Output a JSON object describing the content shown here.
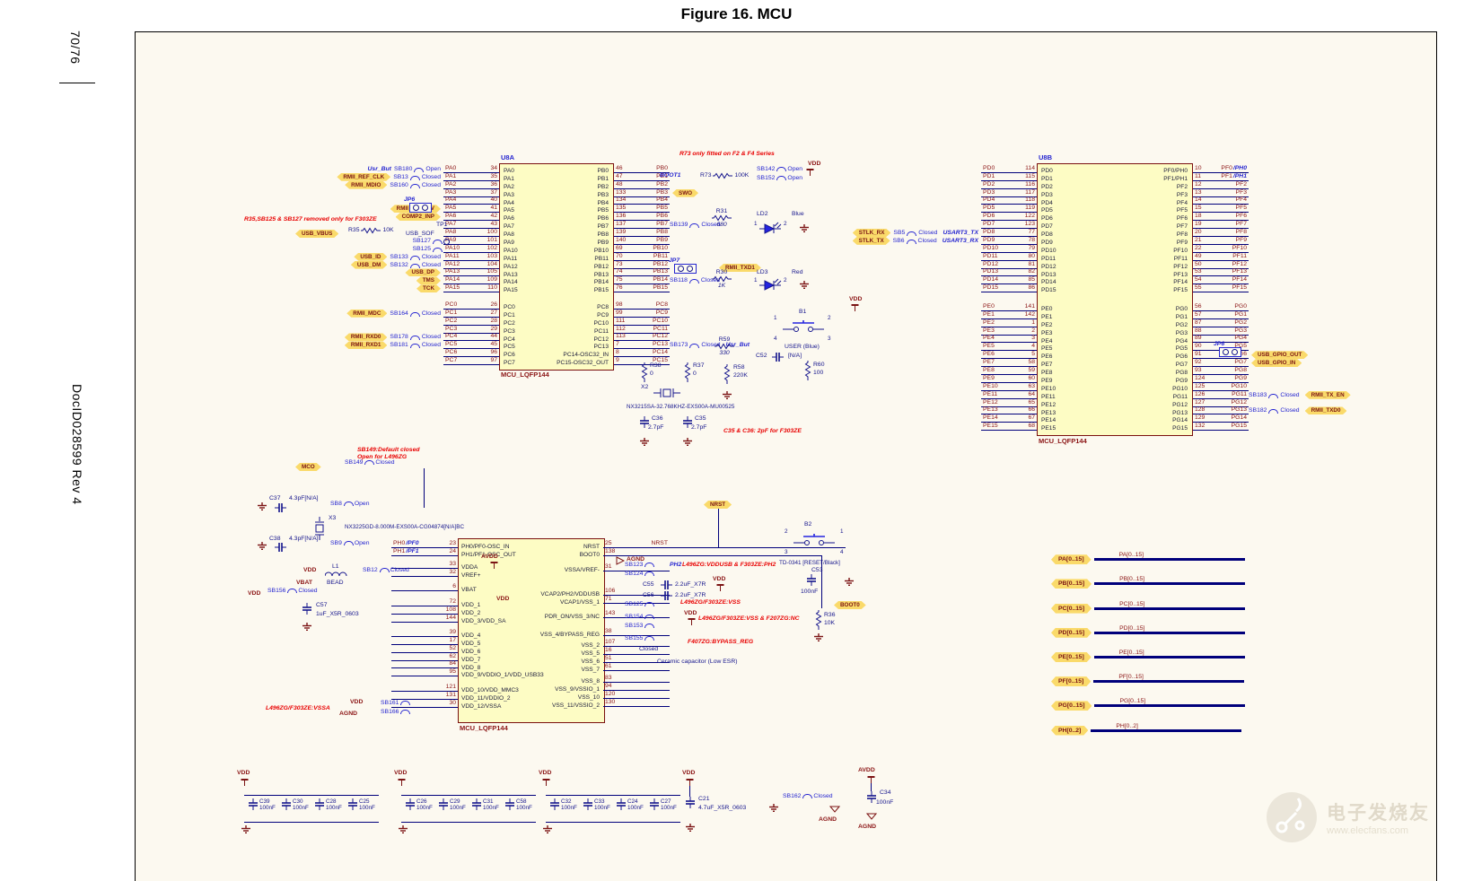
{
  "page": {
    "page_num": "70/76",
    "doc_id": "DocID028599 Rev 4",
    "title": "Figure 16. MCU",
    "watermark_cn": "电子发烧友",
    "watermark_url": "www.elecfans.com"
  },
  "u8a": {
    "ref": "U8A",
    "part": "MCU_LQFP144",
    "pa_rows": [
      {
        "pre": "Usr_But",
        "sb": "SB180",
        "state": "Open",
        "net": "PA0",
        "num": "34"
      },
      {
        "flag": "RMII_REF_CLK",
        "sb": "SB13",
        "state": "Closed",
        "net": "PA1",
        "num": "35"
      },
      {
        "flag": "RMII_MDIO",
        "sb": "SB160",
        "state": "Closed",
        "net": "PA2",
        "num": "36"
      },
      {
        "net": "PA3",
        "num": "37"
      },
      {
        "net": "PA4",
        "num": "40"
      },
      {
        "flag": "RMII_CRS_DV",
        "net": "PA5",
        "num": "41"
      },
      {
        "flag": "COMP2_INP",
        "net": "PA6",
        "num": "42"
      },
      {
        "net": "PA7",
        "num": "43"
      },
      {
        "net": "PA8",
        "num": "100"
      },
      {
        "sb": "SB127",
        "net": "PA9",
        "num": "101"
      },
      {
        "sb": "SB125",
        "net": "PA10",
        "num": "102"
      },
      {
        "flag": "USB_ID",
        "sb": "SB133",
        "state": "Closed",
        "net": "PA11",
        "num": "103"
      },
      {
        "flag": "USB_DM",
        "sb": "SB132",
        "state": "Closed",
        "net": "PA12",
        "num": "104"
      },
      {
        "flag": "USB_DP",
        "net": "PA13",
        "num": "105"
      },
      {
        "flag": "TMS",
        "net": "PA14",
        "num": "109"
      },
      {
        "flag": "TCK",
        "net": "PA15",
        "num": "110"
      }
    ],
    "pc_left_rows": [
      {
        "net": "PC0",
        "num": "26"
      },
      {
        "flag": "RMII_MDC",
        "sb": "SB164",
        "state": "Closed",
        "net": "PC1",
        "num": "27"
      },
      {
        "net": "PC2",
        "num": "28"
      },
      {
        "net": "PC3",
        "num": "29"
      },
      {
        "flag": "RMII_RXD0",
        "sb": "SB178",
        "state": "Closed",
        "net": "PC4",
        "num": "44"
      },
      {
        "flag": "RMII_RXD1",
        "sb": "SB181",
        "state": "Closed",
        "net": "PC5",
        "num": "45"
      },
      {
        "net": "PC6",
        "num": "96"
      },
      {
        "net": "PC7",
        "num": "97"
      }
    ],
    "pb_rows": [
      {
        "num": "46",
        "net": "PB0"
      },
      {
        "num": "47",
        "net": "PB1"
      },
      {
        "num": "48",
        "net": "PB2"
      },
      {
        "num": "133",
        "net": "PB3",
        "flag": "SWO"
      },
      {
        "num": "134",
        "net": "PB4"
      },
      {
        "num": "135",
        "net": "PB5"
      },
      {
        "num": "136",
        "net": "PB6"
      },
      {
        "num": "137",
        "net": "PB7",
        "sb": "SB139",
        "state": "Closed"
      },
      {
        "num": "139",
        "net": "PB8"
      },
      {
        "num": "140",
        "net": "PB9"
      },
      {
        "num": "69",
        "net": "PB10"
      },
      {
        "num": "70",
        "net": "PB11"
      },
      {
        "num": "73",
        "net": "PB12"
      },
      {
        "num": "74",
        "net": "PB13"
      },
      {
        "num": "75",
        "net": "PB14",
        "sb": "SB118",
        "state": "Closed"
      },
      {
        "num": "76",
        "net": "PB15"
      }
    ],
    "pc_right_rows": [
      {
        "num": "98",
        "net": "PC8"
      },
      {
        "num": "99",
        "net": "PC9"
      },
      {
        "num": "111",
        "net": "PC10"
      },
      {
        "num": "112",
        "net": "PC11"
      },
      {
        "num": "113",
        "net": "PC12"
      },
      {
        "num": "7",
        "net": "PC13",
        "sb": "SB173",
        "state": "Closed",
        "post": "Usr_But"
      },
      {
        "num": "8",
        "net": "PC14"
      },
      {
        "num": "9",
        "net": "PC15"
      }
    ],
    "in_pa": [
      "PA0",
      "PA1",
      "PA2",
      "PA3",
      "PA4",
      "PA5",
      "PA6",
      "PA7",
      "PA8",
      "PA9",
      "PA10",
      "PA11",
      "PA12",
      "PA13",
      "PA14",
      "PA15"
    ],
    "in_pc_l": [
      "PC0",
      "PC1",
      "PC2",
      "PC3",
      "PC4",
      "PC5",
      "PC6",
      "PC7"
    ],
    "in_pb": [
      "PB0",
      "PB1",
      "PB2",
      "PB3",
      "PB4",
      "PB5",
      "PB6",
      "PB7",
      "PB8",
      "PB9",
      "PB10",
      "PB11",
      "PB12",
      "PB13",
      "PB14",
      "PB15"
    ],
    "in_pc_r": [
      "PC8",
      "PC9",
      "PC10",
      "PC11",
      "PC12",
      "PC13",
      "PC14-OSC32_IN",
      "PC15-OSC32_OUT"
    ]
  },
  "u8b": {
    "ref": "U8B",
    "part": "MCU_LQFP144",
    "pd_rows": [
      {
        "net": "PD0",
        "num": "114"
      },
      {
        "net": "PD1",
        "num": "115"
      },
      {
        "net": "PD2",
        "num": "116"
      },
      {
        "net": "PD3",
        "num": "117"
      },
      {
        "net": "PD4",
        "num": "118"
      },
      {
        "net": "PD5",
        "num": "119"
      },
      {
        "net": "PD6",
        "num": "122"
      },
      {
        "net": "PD7",
        "num": "123"
      },
      {
        "flag": "STLK_RX",
        "sb": "SB5",
        "state": "Closed",
        "post": "USART3_TX",
        "net": "PD8",
        "num": "77"
      },
      {
        "flag": "STLK_TX",
        "sb": "SB6",
        "state": "Closed",
        "post": "USART3_RX",
        "net": "PD9",
        "num": "78"
      },
      {
        "net": "PD10",
        "num": "79"
      },
      {
        "net": "PD11",
        "num": "80"
      },
      {
        "net": "PD12",
        "num": "81"
      },
      {
        "net": "PD13",
        "num": "82"
      },
      {
        "net": "PD14",
        "num": "85"
      },
      {
        "net": "PD15",
        "num": "86"
      }
    ],
    "pe_rows": [
      {
        "net": "PE0",
        "num": "141"
      },
      {
        "net": "PE1",
        "num": "142"
      },
      {
        "net": "PE2",
        "num": "1"
      },
      {
        "net": "PE3",
        "num": "2"
      },
      {
        "net": "PE4",
        "num": "3"
      },
      {
        "net": "PE5",
        "num": "4"
      },
      {
        "net": "PE6",
        "num": "5"
      },
      {
        "net": "PE7",
        "num": "58"
      },
      {
        "net": "PE8",
        "num": "59"
      },
      {
        "net": "PE9",
        "num": "60"
      },
      {
        "net": "PE10",
        "num": "63"
      },
      {
        "net": "PE11",
        "num": "64"
      },
      {
        "net": "PE12",
        "num": "65"
      },
      {
        "net": "PE13",
        "num": "66"
      },
      {
        "net": "PE14",
        "num": "67"
      },
      {
        "net": "PE15",
        "num": "68"
      }
    ],
    "pf_rows": [
      {
        "num": "10",
        "net": "PF0",
        "alt": "/PH0"
      },
      {
        "num": "11",
        "net": "PF1",
        "alt": "/PH1"
      },
      {
        "num": "12",
        "net": "PF2"
      },
      {
        "num": "13",
        "net": "PF3"
      },
      {
        "num": "14",
        "net": "PF4"
      },
      {
        "num": "15",
        "net": "PF5"
      },
      {
        "num": "18",
        "net": "PF6"
      },
      {
        "num": "19",
        "net": "PF7"
      },
      {
        "num": "20",
        "net": "PF8"
      },
      {
        "num": "21",
        "net": "PF9"
      },
      {
        "num": "22",
        "net": "PF10"
      },
      {
        "num": "49",
        "net": "PF11"
      },
      {
        "num": "50",
        "net": "PF12"
      },
      {
        "num": "53",
        "net": "PF13"
      },
      {
        "num": "54",
        "net": "PF14"
      },
      {
        "num": "55",
        "net": "PF15"
      }
    ],
    "pg_rows": [
      {
        "num": "56",
        "net": "PG0"
      },
      {
        "num": "57",
        "net": "PG1"
      },
      {
        "num": "87",
        "net": "PG2"
      },
      {
        "num": "88",
        "net": "PG3"
      },
      {
        "num": "89",
        "net": "PG4"
      },
      {
        "num": "90",
        "net": "PG5"
      },
      {
        "num": "91",
        "net": "PG6",
        "flag": "USB_GPIO_OUT"
      },
      {
        "num": "92",
        "net": "PG7",
        "flag": "USB_GPIO_IN"
      },
      {
        "num": "93",
        "net": "PG8"
      },
      {
        "num": "124",
        "net": "PG9"
      },
      {
        "num": "125",
        "net": "PG10"
      },
      {
        "num": "126",
        "net": "PG11",
        "sb": "SB183",
        "state": "Closed",
        "flag": "RMII_TX_EN"
      },
      {
        "num": "127",
        "net": "PG12"
      },
      {
        "num": "128",
        "net": "PG13",
        "sb": "SB182",
        "state": "Closed",
        "flag": "RMII_TXD0"
      },
      {
        "num": "129",
        "net": "PG14"
      },
      {
        "num": "132",
        "net": "PG15"
      }
    ],
    "in_pd": [
      "PD0",
      "PD1",
      "PD2",
      "PD3",
      "PD4",
      "PD5",
      "PD6",
      "PD7",
      "PD8",
      "PD9",
      "PD10",
      "PD11",
      "PD12",
      "PD13",
      "PD14",
      "PD15"
    ],
    "in_pe": [
      "PE0",
      "PE1",
      "PE2",
      "PE3",
      "PE4",
      "PE5",
      "PE6",
      "PE7",
      "PE8",
      "PE9",
      "PE10",
      "PE11",
      "PE12",
      "PE13",
      "PE14",
      "PE15"
    ],
    "in_pf": [
      "PF0/PH0",
      "PF1/PH1",
      "PF2",
      "PF3",
      "PF4",
      "PF5",
      "PF6",
      "PF7",
      "PF8",
      "PF9",
      "PF10",
      "PF11",
      "PF12",
      "PF13",
      "PF14",
      "PF15"
    ],
    "in_pg": [
      "PG0",
      "PG1",
      "PG2",
      "PG3",
      "PG4",
      "PG5",
      "PG6",
      "PG7",
      "PG8",
      "PG9",
      "PG10",
      "PG11",
      "PG12",
      "PG13",
      "PG14",
      "PG15"
    ]
  },
  "pwr": {
    "part": "MCU_LQFP144",
    "l1": [
      {
        "net": "PH0",
        "alt": "/PF0",
        "num": "23"
      },
      {
        "net": "PH1",
        "alt": "/PF1",
        "num": "24"
      }
    ],
    "l2": [
      {
        "num": "33"
      },
      {
        "num": "32"
      }
    ],
    "l3": [
      {
        "num": "6"
      }
    ],
    "l4": [
      {
        "num": "72"
      },
      {
        "num": "108"
      },
      {
        "num": "144"
      }
    ],
    "l5": [
      {
        "num": "39"
      },
      {
        "num": "17"
      },
      {
        "num": "52"
      },
      {
        "num": "62"
      },
      {
        "num": "84"
      },
      {
        "num": "95"
      }
    ],
    "l6": [
      {
        "num": "121"
      },
      {
        "num": "131"
      },
      {
        "num": "30"
      }
    ],
    "r1": [
      {
        "num": "25",
        "net": "NRST"
      },
      {
        "num": "138"
      }
    ],
    "r2": [
      {
        "num": "31"
      }
    ],
    "r3": [
      {
        "num": "106"
      },
      {
        "num": "71"
      }
    ],
    "r4": [
      {
        "num": "143"
      }
    ],
    "r5": [
      {
        "num": "38"
      }
    ],
    "r6": [
      {
        "num": "107"
      },
      {
        "num": "16"
      },
      {
        "num": "51"
      },
      {
        "num": "61"
      }
    ],
    "r7": [
      {
        "num": "83"
      },
      {
        "num": "94"
      },
      {
        "num": "120"
      },
      {
        "num": "130"
      }
    ],
    "in_l1": [
      "PH0/PF0-OSC_IN",
      "PH1/PF1-OSC_OUT"
    ],
    "in_l2": [
      "VDDA",
      "VREF+"
    ],
    "in_l3": [
      "VBAT"
    ],
    "in_l4": [
      "VDD_1",
      "VDD_2",
      "VDD_3/VDD_SA"
    ],
    "in_l5": [
      "VDD_4",
      "VDD_5",
      "VDD_6",
      "VDD_7",
      "VDD_8",
      "VDD_9/VDDIO_1/VDD_USB33"
    ],
    "in_l6": [
      "VDD_10/VDD_MMC3",
      "VDD_11/VDDIO_2",
      "VDD_12/VSSA"
    ],
    "in_r1": [
      "NRST",
      "BOOT0"
    ],
    "in_r2": [
      "VSSA/VREF-"
    ],
    "in_r3": [
      "VCAP2/PH2/VDDUSB",
      "VCAP1/VSS_1"
    ],
    "in_r4": [
      "PDR_ON/VSS_3/NC"
    ],
    "in_r5": [
      "VSS_4/BYPASS_REG"
    ],
    "in_r6": [
      "VSS_2",
      "VSS_5",
      "VSS_6",
      "VSS_7"
    ],
    "in_r7": [
      "VSS_8",
      "VSS_9/VSSIO_1",
      "VSS_10",
      "VSS_11/VSSIO_2"
    ]
  },
  "buses": [
    {
      "flag": "PA[0..15]",
      "net": "PA[0..15]"
    },
    {
      "flag": "PB[0..15]",
      "net": "PB[0..15]"
    },
    {
      "flag": "PC[0..15]",
      "net": "PC[0..15]"
    },
    {
      "flag": "PD[0..15]",
      "net": "PD[0..15]"
    },
    {
      "flag": "PE[0..15]",
      "net": "PE[0..15]"
    },
    {
      "flag": "PF[0..15]",
      "net": "PF[0..15]"
    },
    {
      "flag": "PG[0..15]",
      "net": "PG[0..15]"
    },
    {
      "flag": "PH[0..2]",
      "net": "PH[0..2]"
    }
  ],
  "bank1": [
    {
      "ref": "C39",
      "val": "100nF"
    },
    {
      "ref": "C30",
      "val": "100nF"
    },
    {
      "ref": "C28",
      "val": "100nF"
    },
    {
      "ref": "C25",
      "val": "100nF"
    }
  ],
  "bank2": [
    {
      "ref": "C26",
      "val": "100nF"
    },
    {
      "ref": "C29",
      "val": "100nF"
    },
    {
      "ref": "C31",
      "val": "100nF"
    },
    {
      "ref": "C58",
      "val": "100nF"
    }
  ],
  "bank3": [
    {
      "ref": "C32",
      "val": "100nF"
    },
    {
      "ref": "C33",
      "val": "100nF"
    },
    {
      "ref": "C24",
      "val": "100nF"
    },
    {
      "ref": "C27",
      "val": "100nF"
    }
  ],
  "c": {
    "r35_note": "R35,SB125 & SB127 removed only for F303ZE",
    "usb_vbus": "USB_VBUS",
    "r35": "R35",
    "r35v": "10K",
    "jp6": "JP6",
    "tp1": "TP1",
    "usb_sof": "USB_SOF",
    "r73_note": "R73 only fitted on F2 & F4 Series",
    "boot1": "BOOT1",
    "r73": "R73",
    "r73v": "100K",
    "sb142": "SB142",
    "sb152": "SB152",
    "open": "Open",
    "closed": "Closed",
    "vdd": "VDD",
    "avdd": "AVDD",
    "agnd": "AGND",
    "vbat": "VBAT",
    "r31": "R31",
    "r31v": "680",
    "ld2": "LD2",
    "ld2c": "Blue",
    "p1": "1",
    "p2": "2",
    "p3": "3",
    "p4": "4",
    "jp7": "JP7",
    "rmii_txd1": "RMII_TXD1",
    "r30": "R30",
    "r30v": "1K",
    "ld3": "LD3",
    "ld3c": "Red",
    "b1": "B1",
    "b1name": "USER (Blue)",
    "r59": "R59",
    "r59v": "330",
    "c52": "C52",
    "c52v": "[N/A]",
    "r58": "R58",
    "r58v": "220K",
    "r60": "R60",
    "r60v": "100",
    "r38": "R38",
    "r38v": "0",
    "r37": "R37",
    "r37v": "0",
    "x2": "X2",
    "x2part": "NX3215SA-32.768KHZ-EXS00A-MU00525",
    "c36": "C36",
    "c36v": "2.7pF",
    "c35": "C35",
    "c35v": "2.7pF",
    "c3536_note": "C35 & C36: 2pF for F303ZE",
    "mco": "MCO",
    "sb149": "SB149",
    "sb149_note1": "SB149:Default closed",
    "sb149_note2": "Open for L496ZG",
    "c37": "C37",
    "c37v": "4.3pF[N/A]",
    "sb8": "SB8",
    "x3": "X3",
    "x3part": "NX3225GD-8.000M-EXS00A-CG04874[N/A]BC",
    "c38": "C38",
    "c38v": "4.3pF[N/A]",
    "sb9": "SB9",
    "l1": "L1",
    "l1v": "BEAD",
    "sb12": "SB12",
    "sb156": "SB156",
    "c57": "C57",
    "c57v": "1uF_X5R_0603",
    "nrst": "NRST",
    "b2": "B2",
    "b2part": "TD-0341 [RESET/Black]",
    "c53": "C53",
    "c53v": "100nF",
    "sb123": "SB123",
    "sb124": "SB124",
    "ph2": "PH2",
    "c55": "C55",
    "c55v": "2.2uF_X7R",
    "c56": "C56",
    "c56v": "2.2uF_X7R",
    "sb125": "SB125",
    "sb154": "SB154",
    "sb153": "SB153",
    "sb155": "SB155",
    "vddusb_note": "L496ZG:VDDUSB & F303ZE:PH2",
    "vss_note": "L496ZG/F303ZE:VSS",
    "vss_nc_note": "L496ZG/F303ZE:VSS & F207ZG:NC",
    "bypass_note": "F407ZG:BYPASS_REG",
    "ceramic_note": "Ceramic capacitor (Low ESR)",
    "boot0": "BOOT0",
    "r36": "R36",
    "r36v": "10K",
    "sb161": "SB161",
    "sb166": "SB166",
    "vssa_note": "L496ZG/F303ZE:VSSA",
    "c21": "C21",
    "c21v": "4.7uF_X5R_0603",
    "sb162": "SB162",
    "c34": "C34",
    "c34v": "100nF"
  }
}
